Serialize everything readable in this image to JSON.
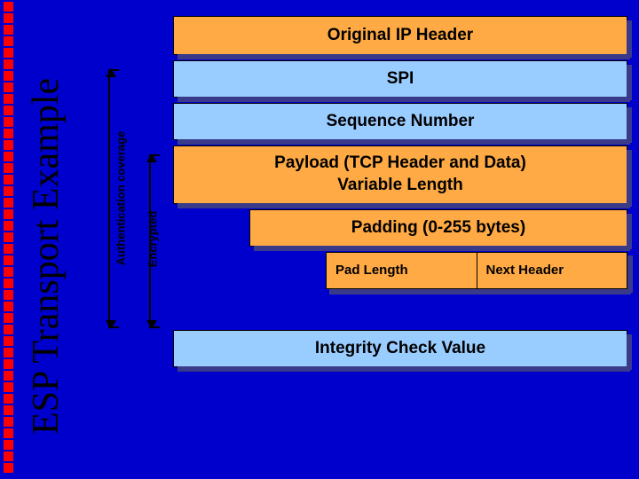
{
  "title": "ESP Transport Example",
  "labels": {
    "auth": "Authentication coverage",
    "enc": "Encrypted"
  },
  "rows": {
    "ip_header": "Original IP Header",
    "spi": "SPI",
    "seq": "Sequence Number",
    "payload": "Payload (TCP Header and Data)\nVariable Length",
    "padding": "Padding (0-255 bytes)",
    "pad_len": "Pad Length",
    "next_hdr": "Next Header",
    "icv": "Integrity Check Value"
  },
  "colors": {
    "bg": "#0000cc",
    "accent": "#ff0000",
    "orange": "#ffaa44",
    "blue": "#99ccff"
  }
}
